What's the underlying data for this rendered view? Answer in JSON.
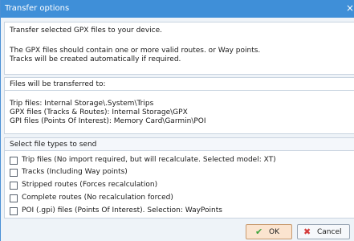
{
  "window": {
    "title": "Transfer options",
    "close_glyph": "×"
  },
  "info": {
    "line1": "Transfer selected GPX files to your device.",
    "line2": "The GPX files should contain one or more valid routes. or Way points.",
    "line3": "Tracks will be created automatically if  required."
  },
  "destinations": {
    "header": "Files will be transferred to:",
    "trip": "Trip files: Internal Storage\\.System\\Trips",
    "gpx": "GPX files (Tracks & Routes): Internal Storage\\GPX",
    "gpi": "GPI files (Points Of Interest): Memory Card\\Garmin\\POI"
  },
  "file_types": {
    "header": "Select file types to send",
    "options": [
      {
        "label": "Trip files (No import required, but will recalculate. Selected model: XT)",
        "checked": false
      },
      {
        "label": "Tracks (Including Way points)",
        "checked": false
      },
      {
        "label": "Stripped routes (Forces recalculation)",
        "checked": false
      },
      {
        "label": "Complete routes (No recalculation forced)",
        "checked": false
      },
      {
        "label": "POI (.gpi) files (Points Of Interest). Selection: WayPoints",
        "checked": false
      }
    ]
  },
  "buttons": {
    "ok_label": "OK",
    "ok_icon": "checkmark-icon",
    "ok_glyph": "✔",
    "cancel_label": "Cancel",
    "cancel_icon": "x-mark-icon",
    "cancel_glyph": "✖"
  },
  "colors": {
    "titlebar": "#3f8fd8",
    "ok_button_bg": "#fbe4cf",
    "ok_icon": "#3aa33a",
    "cancel_icon": "#d43b3b"
  }
}
